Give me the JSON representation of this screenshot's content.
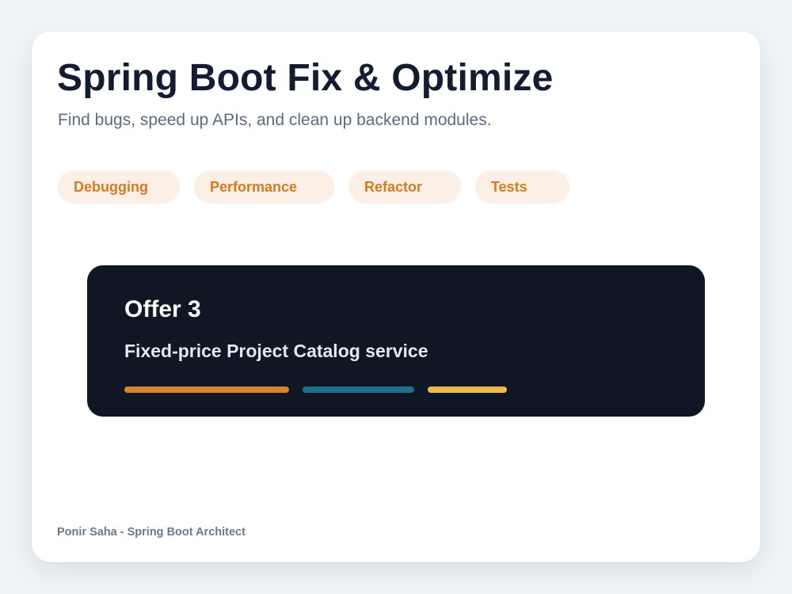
{
  "header": {
    "title": "Spring Boot Fix & Optimize",
    "subtitle": "Find bugs, speed up APIs, and clean up backend modules."
  },
  "tags": [
    {
      "label": "Debugging"
    },
    {
      "label": "Performance"
    },
    {
      "label": "Refactor"
    },
    {
      "label": "Tests"
    }
  ],
  "offer": {
    "title": "Offer 3",
    "description": "Fixed-price Project Catalog service",
    "accent_bars": [
      {
        "color": "#d9822b"
      },
      {
        "color": "#1f6e8c"
      },
      {
        "color": "#f2b84b"
      }
    ]
  },
  "footer": {
    "author": "Ponir Saha - Spring Boot Architect"
  },
  "colors": {
    "background": "#eef3f7",
    "card": "#ffffff",
    "title": "#131c31",
    "tag_background": "#fbefe6",
    "tag_text": "#d57b23",
    "offer_background": "#0f1624"
  }
}
